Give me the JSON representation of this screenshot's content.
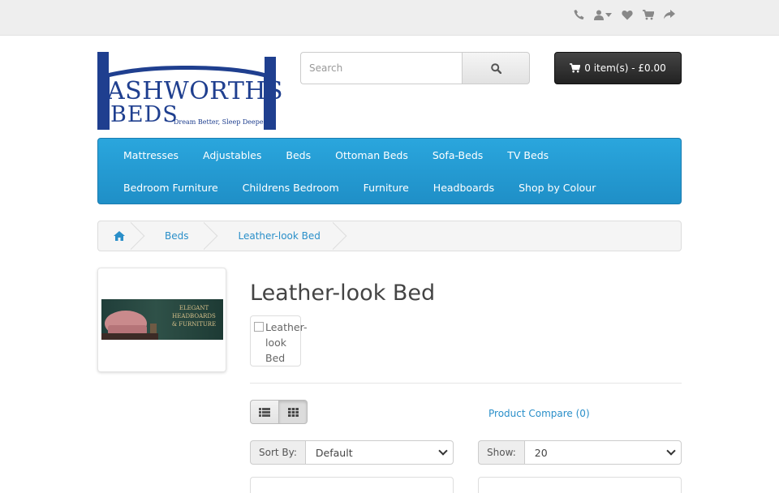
{
  "topbar": {
    "icons": [
      "phone-icon",
      "user-icon",
      "heart-icon",
      "cart-icon",
      "share-icon"
    ]
  },
  "logo": {
    "line1": "ASHWORTHS",
    "line2": "BEDS",
    "tagline": "Dream Better, Sleep Deeper",
    "color": "#1f3f8f"
  },
  "search": {
    "placeholder": "Search"
  },
  "cart": {
    "label": "0 item(s) - £0.00"
  },
  "menu": {
    "items": [
      "Mattresses",
      "Adjustables",
      "Beds",
      "Ottoman Beds",
      "Sofa-Beds",
      "TV Beds",
      "Bedroom Furniture",
      "Childrens Bedroom",
      "Furniture",
      "Headboards",
      "Shop by Colour"
    ]
  },
  "breadcrumb": {
    "items": [
      "Beds",
      "Leather-look Bed"
    ]
  },
  "sidebar_banner": {
    "line1": "ELEGANT",
    "line2": "HEADBOARDS",
    "line3": "& FURNITURE"
  },
  "page": {
    "title": "Leather-look Bed",
    "image_alt": "Leather-look Bed"
  },
  "toolbar": {
    "compare": "Product Compare (0)",
    "sort_label": "Sort By:",
    "sort_value": "Default",
    "show_label": "Show:",
    "show_value": "20"
  },
  "colors": {
    "accent": "#2a8fc9",
    "menu": "#229bd4"
  }
}
